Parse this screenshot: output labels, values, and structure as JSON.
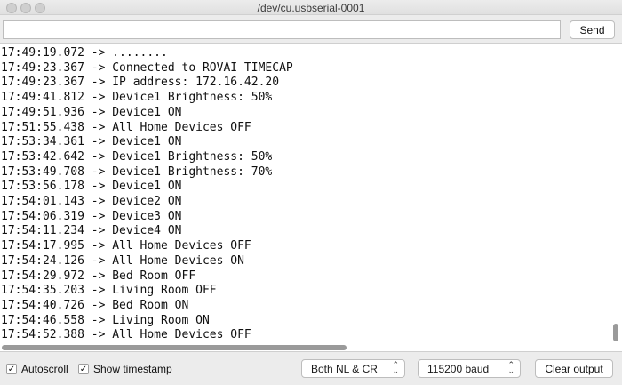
{
  "window": {
    "title": "/dev/cu.usbserial-0001"
  },
  "toolbar": {
    "input_value": "",
    "send_label": "Send"
  },
  "console": {
    "lines": [
      "17:49:19.072 -> ........",
      "17:49:23.367 -> Connected to ROVAI TIMECAP",
      "17:49:23.367 -> IP address: 172.16.42.20",
      "17:49:41.812 -> Device1 Brightness: 50%",
      "17:49:51.936 -> Device1 ON",
      "17:51:55.438 -> All Home Devices OFF",
      "17:53:34.361 -> Device1 ON",
      "17:53:42.642 -> Device1 Brightness: 50%",
      "17:53:49.708 -> Device1 Brightness: 70%",
      "17:53:56.178 -> Device1 ON",
      "17:54:01.143 -> Device2 ON",
      "17:54:06.319 -> Device3 ON",
      "17:54:11.234 -> Device4 ON",
      "17:54:17.995 -> All Home Devices OFF",
      "17:54:24.126 -> All Home Devices ON",
      "17:54:29.972 -> Bed Room OFF",
      "17:54:35.203 -> Living Room OFF",
      "17:54:40.726 -> Bed Room ON",
      "17:54:46.558 -> Living Room ON",
      "17:54:52.388 -> All Home Devices OFF"
    ]
  },
  "statusbar": {
    "autoscroll_label": "Autoscroll",
    "autoscroll_checked": true,
    "timestamp_label": "Show timestamp",
    "timestamp_checked": true,
    "line_ending": "Both NL & CR",
    "baud_rate": "115200 baud",
    "clear_label": "Clear output",
    "check_mark": "✓",
    "chevron_glyph": "⌃⌄"
  }
}
